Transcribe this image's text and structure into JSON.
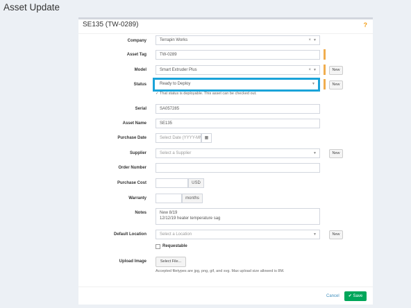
{
  "page": {
    "title": "Asset Update"
  },
  "panel": {
    "title": "SE135 (TW-0289)",
    "help": "?"
  },
  "fields": {
    "company": {
      "label": "Company",
      "value": "Terrapin Works",
      "clear": "×"
    },
    "asset_tag": {
      "label": "Asset Tag",
      "value": "TW-0289"
    },
    "model": {
      "label": "Model",
      "value": "Smart Extruder Plus",
      "clear": "×",
      "new_label": "New"
    },
    "status": {
      "label": "Status",
      "value": "Ready to Deploy",
      "new_label": "New",
      "help": "✓ That status is deployable. This asset can be checked out."
    },
    "serial": {
      "label": "Serial",
      "value": "SA057285"
    },
    "asset_name": {
      "label": "Asset Name",
      "value": "SE135"
    },
    "purchase_date": {
      "label": "Purchase Date",
      "placeholder": "Select Date (YYYY-MM-D"
    },
    "supplier": {
      "label": "Supplier",
      "placeholder": "Select a Supplier",
      "new_label": "New"
    },
    "order_number": {
      "label": "Order Number",
      "value": ""
    },
    "purchase_cost": {
      "label": "Purchase Cost",
      "currency": "USD"
    },
    "warranty": {
      "label": "Warranty",
      "unit": "months"
    },
    "notes": {
      "label": "Notes",
      "line1": "New 8/19",
      "line2": "12/12/19 heater temperature sag"
    },
    "default_location": {
      "label": "Default Location",
      "placeholder": "Select a Location",
      "new_label": "New"
    },
    "requestable": {
      "label": "Requestable",
      "checked": false
    },
    "upload_image": {
      "label": "Upload Image",
      "button": "Select File...",
      "help": "Accepted filetypes are jpg, png, gif, and svg. Max upload size allowed is 8M."
    }
  },
  "footer": {
    "cancel": "Cancel",
    "save": "Save"
  },
  "colors": {
    "accent": "#00a65a",
    "highlight": "#1aa3d9",
    "required": "#f0ad4e",
    "link": "#3c8dbc"
  }
}
